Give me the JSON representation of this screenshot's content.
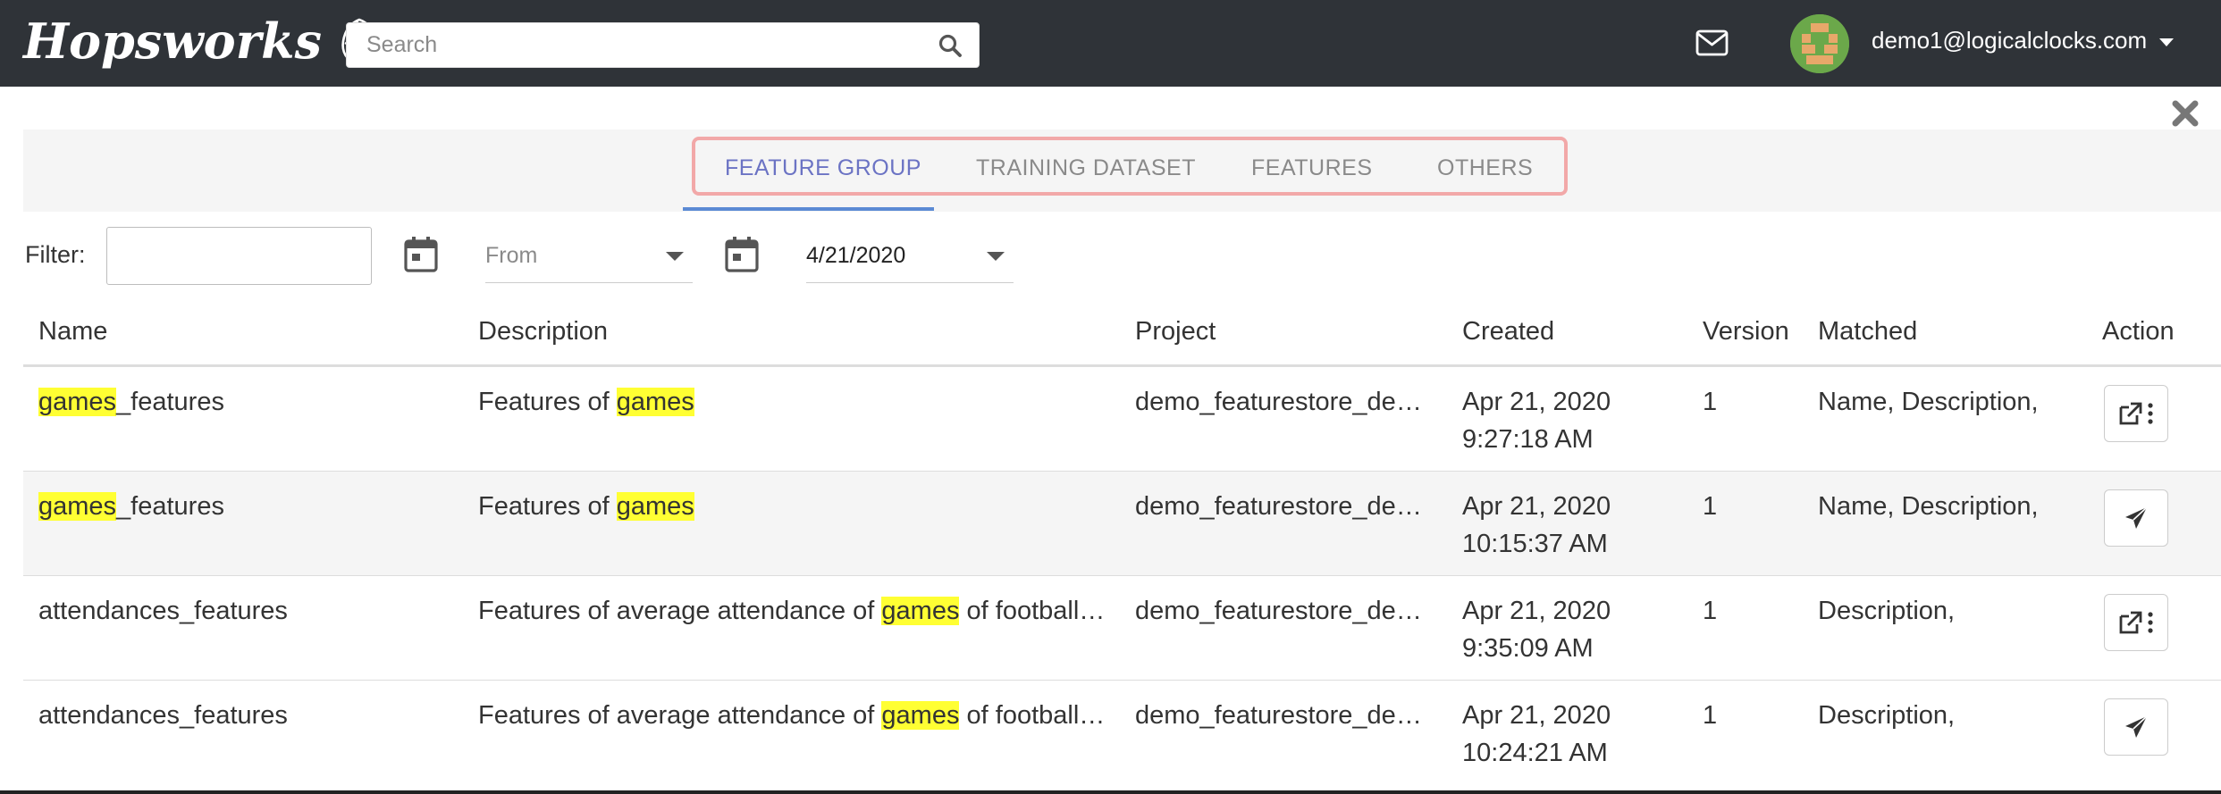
{
  "navbar": {
    "logo_text": "Hopsworks",
    "search_placeholder": "Search",
    "user_email": "demo1@logicalclocks.com",
    "icons": [
      "hop-icon",
      "search-icon",
      "mail-icon",
      "avatar",
      "caret-down-icon"
    ]
  },
  "tabs": [
    {
      "label": "FEATURE GROUP",
      "active": true
    },
    {
      "label": "TRAINING DATASET",
      "active": false
    },
    {
      "label": "FEATURES",
      "active": false
    },
    {
      "label": "OTHERS",
      "active": false
    }
  ],
  "filters": {
    "filter_label": "Filter:",
    "filter_value": "",
    "from_placeholder": "From",
    "to_value": "4/21/2020"
  },
  "table": {
    "columns": [
      "Name",
      "Description",
      "Project",
      "Created",
      "Version",
      "Matched",
      "Action"
    ],
    "highlight_term": "games",
    "rows": [
      {
        "name_pre": "",
        "name_hl": "games",
        "name_post": "_features",
        "desc_pre": "Features of ",
        "desc_hl": "games",
        "desc_post": "",
        "project": "demo_featurestore_de…",
        "created_date": "Apr 21, 2020",
        "created_time": "9:27:18 AM",
        "version": "1",
        "matched": "Name, Description,",
        "action_icon": "external-link-icon"
      },
      {
        "name_pre": "",
        "name_hl": "games",
        "name_post": "_features",
        "desc_pre": "Features of ",
        "desc_hl": "games",
        "desc_post": "",
        "project": "demo_featurestore_de…",
        "created_date": "Apr 21, 2020",
        "created_time": "10:15:37 AM",
        "version": "1",
        "matched": "Name, Description,",
        "action_icon": "send-icon"
      },
      {
        "name_pre": "attendances_features",
        "name_hl": "",
        "name_post": "",
        "desc_pre": "Features of average attendance of ",
        "desc_hl": "games",
        "desc_post": " of football…",
        "project": "demo_featurestore_de…",
        "created_date": "Apr 21, 2020",
        "created_time": "9:35:09 AM",
        "version": "1",
        "matched": "Description,",
        "action_icon": "external-link-icon"
      },
      {
        "name_pre": "attendances_features",
        "name_hl": "",
        "name_post": "",
        "desc_pre": "Features of average attendance of ",
        "desc_hl": "games",
        "desc_post": " of football…",
        "project": "demo_featurestore_de…",
        "created_date": "Apr 21, 2020",
        "created_time": "10:24:21 AM",
        "version": "1",
        "matched": "Description,",
        "action_icon": "send-icon"
      }
    ]
  },
  "colors": {
    "navbar": "#2f3338",
    "active_tab": "#6b73c4",
    "tab_underline": "#5b8ad4",
    "tab_outline": "#f2a8a8",
    "highlight": "#ffff33",
    "alt_row": "#f5f5f5"
  }
}
